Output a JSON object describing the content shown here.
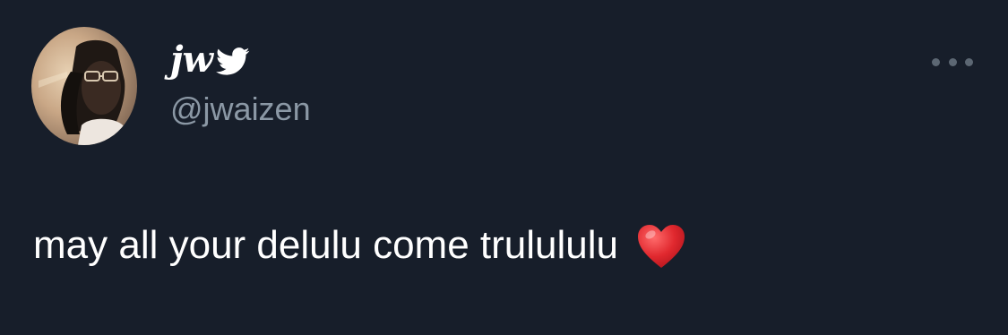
{
  "author": {
    "display_name": "jw",
    "handle": "@jwaizen",
    "avatar_icon": "profile-photo",
    "badge_icon": "twitter-bird-icon"
  },
  "tweet": {
    "text": "may all your delulu come trulululu",
    "emoji_icon": "red-heart-icon"
  },
  "actions": {
    "more_icon": "more-options-icon"
  },
  "colors": {
    "background": "#171e2a",
    "text_primary": "#ffffff",
    "text_secondary": "#8b98a5",
    "heart": "#e0282e"
  }
}
